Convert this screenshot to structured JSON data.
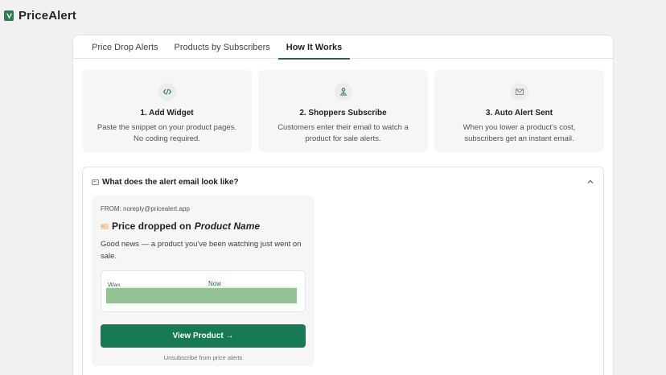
{
  "app": {
    "title": "PriceAlert"
  },
  "tabs": [
    {
      "label": "Price Drop Alerts",
      "active": false
    },
    {
      "label": "Products by Subscribers",
      "active": false
    },
    {
      "label": "How It Works",
      "active": true
    }
  ],
  "steps": [
    {
      "icon": "code-icon",
      "title": "1. Add Widget",
      "description": "Paste the snippet on your product pages. No coding required."
    },
    {
      "icon": "person-icon",
      "title": "2. Shoppers Subscribe",
      "description": "Customers enter their email to watch a product for sale alerts."
    },
    {
      "icon": "mail-icon",
      "title": "3. Auto Alert Sent",
      "description": "When you lower a product's cost, subscribers get an instant email."
    }
  ],
  "accordion": {
    "title": "What does the alert email look like?",
    "expanded": true
  },
  "email": {
    "from": "FROM: noreply@pricealert.app",
    "subject_prefix": "Price dropped on",
    "product_name": "Product Name",
    "body": "Good news — a product you've been watching just went on sale.",
    "was_label": "Was",
    "now_label": "Now",
    "now_fraction": 1.0,
    "cta_label": "View Product →",
    "unsubscribe": "Unsubscribe from price alerts"
  },
  "colors": {
    "brand": "#2e7d4f",
    "cta": "#177a55",
    "bar_fill": "#93c294",
    "tab_underline": "#1f6b4a"
  }
}
